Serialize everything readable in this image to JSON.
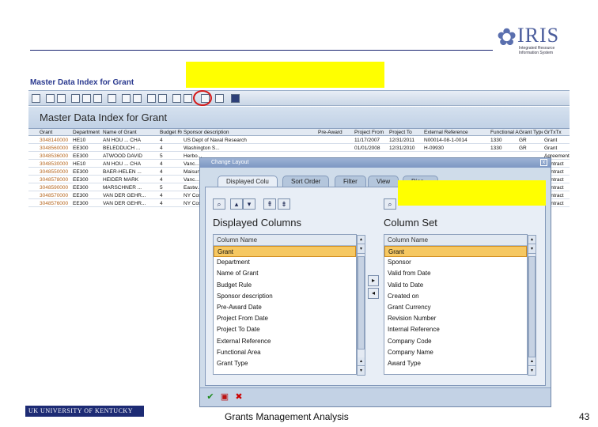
{
  "logo": {
    "word": "IRIS",
    "sub": "Integrated Resource Information System"
  },
  "master": {
    "title": "Master Data Index for Grant"
  },
  "grid": {
    "title": "Master Data Index for Grant",
    "columns": [
      "Grant",
      "Department",
      "Name of Grant",
      "Budget Rule",
      "Sponsor description",
      "Pre-Award",
      "Project From",
      "Project To",
      "External Reference",
      "Functional Area",
      "Grant Type",
      "GrTxTx"
    ],
    "rows": [
      [
        "3048140000",
        "HE10",
        "AN HOU ... CHA",
        "4",
        "US Dept of Naval Research",
        "",
        "11/17/2007",
        "12/31/2011",
        "N00014-08-1-0014",
        "1330",
        "GR",
        "Grant"
      ],
      [
        "3048560000",
        "EE300",
        "BELEDDUCH ...",
        "4",
        "Washington S...",
        "",
        "01/01/2008",
        "12/31/2010",
        "H-09930",
        "1330",
        "GR",
        "Grant"
      ],
      [
        "3048536000",
        "EE300",
        "ATWOOD DAVID",
        "5",
        "Herbo...",
        "",
        "",
        "",
        "",
        "",
        "",
        "Agreement"
      ],
      [
        "3048530000",
        "HE10",
        "AN HOU ... CHA",
        "4",
        "Vanc...",
        "",
        "",
        "",
        "",
        "",
        "",
        "Contract"
      ],
      [
        "3048550000",
        "EE300",
        "BAER-HELEN ...",
        "4",
        "Maisun...",
        "",
        "",
        "",
        "",
        "",
        "",
        "Contract"
      ],
      [
        "3048578000",
        "EE300",
        "HEIDER MARK",
        "4",
        "Vanc...",
        "",
        "",
        "",
        "",
        "",
        "",
        "Contract"
      ],
      [
        "3048590000",
        "EE300",
        "MARSCHNER ...",
        "5",
        "Eastw...",
        "",
        "",
        "",
        "",
        "",
        "",
        "Contract"
      ],
      [
        "3048570000",
        "EE300",
        "VAN DER GEHR...",
        "4",
        "NY Cos...",
        "",
        "",
        "",
        "",
        "",
        "",
        "Contract"
      ],
      [
        "3048576000",
        "EE300",
        "VAN DER GEHR...",
        "4",
        "NY Cos...",
        "",
        "",
        "",
        "",
        "",
        "",
        "Contract"
      ]
    ]
  },
  "dialog": {
    "title": "Change Layout",
    "close": "x",
    "tabs": [
      "Displayed Colu",
      "Sort Order",
      "Filter",
      "View",
      "Disp..."
    ],
    "left": {
      "title": "Displayed Columns",
      "header": "Column Name",
      "items": [
        "Grant",
        "Department",
        "Name of Grant",
        "Budget Rule",
        "Sponsor description",
        "Pre-Award Date",
        "Project From Date",
        "Project To Date",
        "External Reference",
        "Functional Area",
        "Grant Type"
      ]
    },
    "right": {
      "title": "Column Set",
      "header": "Column Name",
      "items": [
        "Grant",
        "Sponsor",
        "Valid from Date",
        "Valid to Date",
        "Created on",
        "Grant Currency",
        "Revision Number",
        "Internal Reference",
        "Company Code",
        "Company Name",
        "Award Type"
      ]
    }
  },
  "footer": {
    "uk_logo": "UK UNIVERSITY OF KENTUCKY",
    "title": "Grants Management Analysis",
    "page": "43"
  }
}
